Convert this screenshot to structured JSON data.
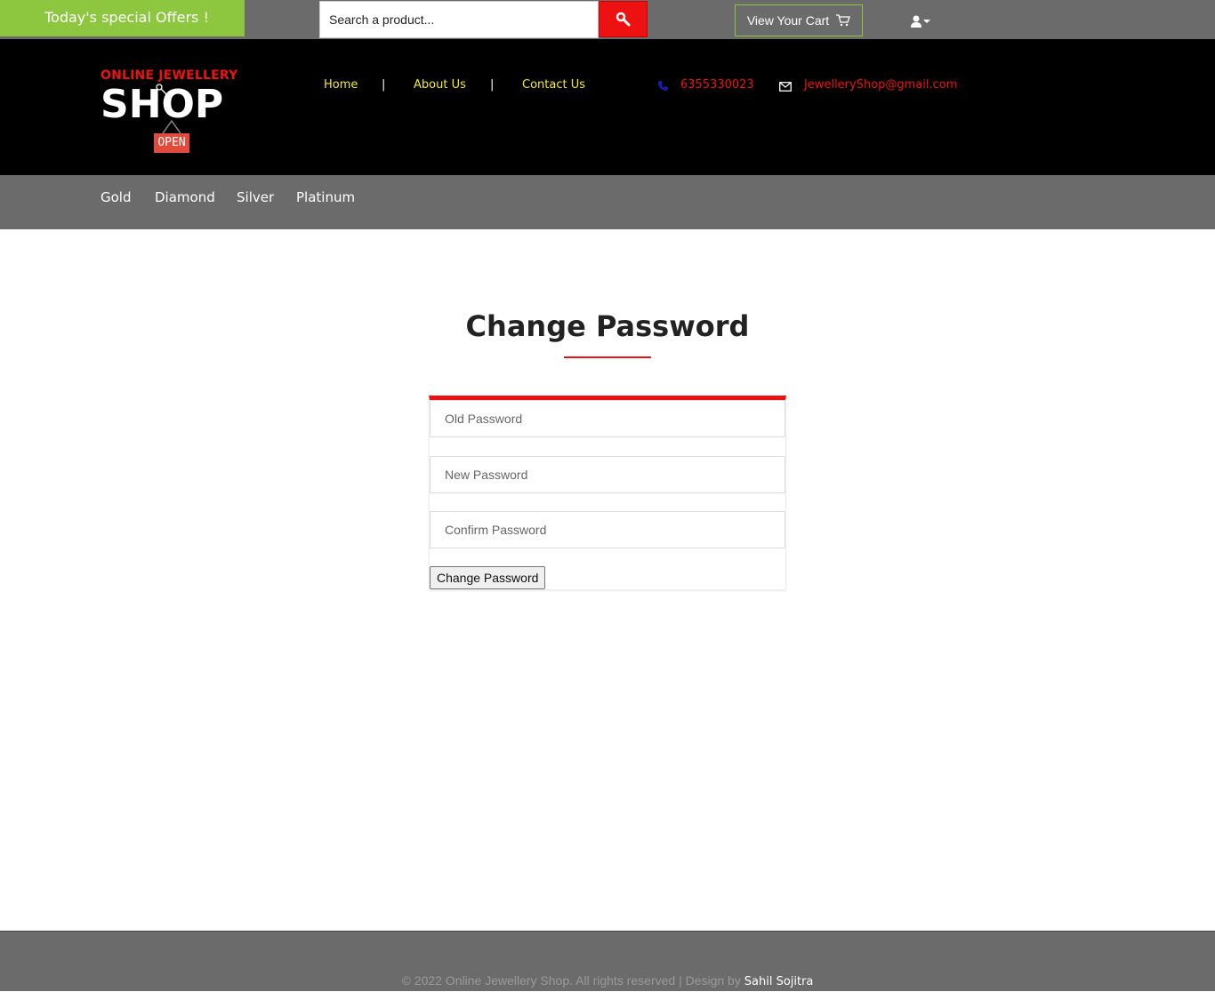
{
  "topbar": {
    "offers_label": "Today's special Offers !",
    "search_placeholder": "Search a product...",
    "search_icon": "search-icon",
    "cart_label": "View Your Cart",
    "cart_icon": "cart-icon",
    "user_icon": "user-icon"
  },
  "header": {
    "logo": {
      "top_text": "ONLINE JEWELLERY",
      "main_text": "SHOP",
      "sign_text": "OPEN"
    },
    "nav": {
      "home": "Home",
      "about": "About Us",
      "contact": "Contact Us",
      "separator": "|"
    },
    "contact": {
      "phone_icon": "phone-icon",
      "phone": "6355330023",
      "email_icon": "envelope-icon",
      "email": "JewelleryShop@gmail.com"
    }
  },
  "categories": {
    "gold": "Gold",
    "diamond": "Diamond",
    "silver": "Silver",
    "platinum": "Platinum"
  },
  "main": {
    "title": "Change Password",
    "form": {
      "old_password_placeholder": "Old Password",
      "new_password_placeholder": "New Password",
      "confirm_password_placeholder": "Confirm Password",
      "submit_label": "Change Password"
    }
  },
  "footer": {
    "copyright": "© 2022 Online Jewellery Shop. All rights reserved | Design by",
    "author": "Sahil Sojitra"
  },
  "colors": {
    "accent_red": "#ee1111",
    "offers_green": "#8dc63f",
    "nav_yellow": "#f7ea1a",
    "bar_gray": "#6b6b6b"
  }
}
